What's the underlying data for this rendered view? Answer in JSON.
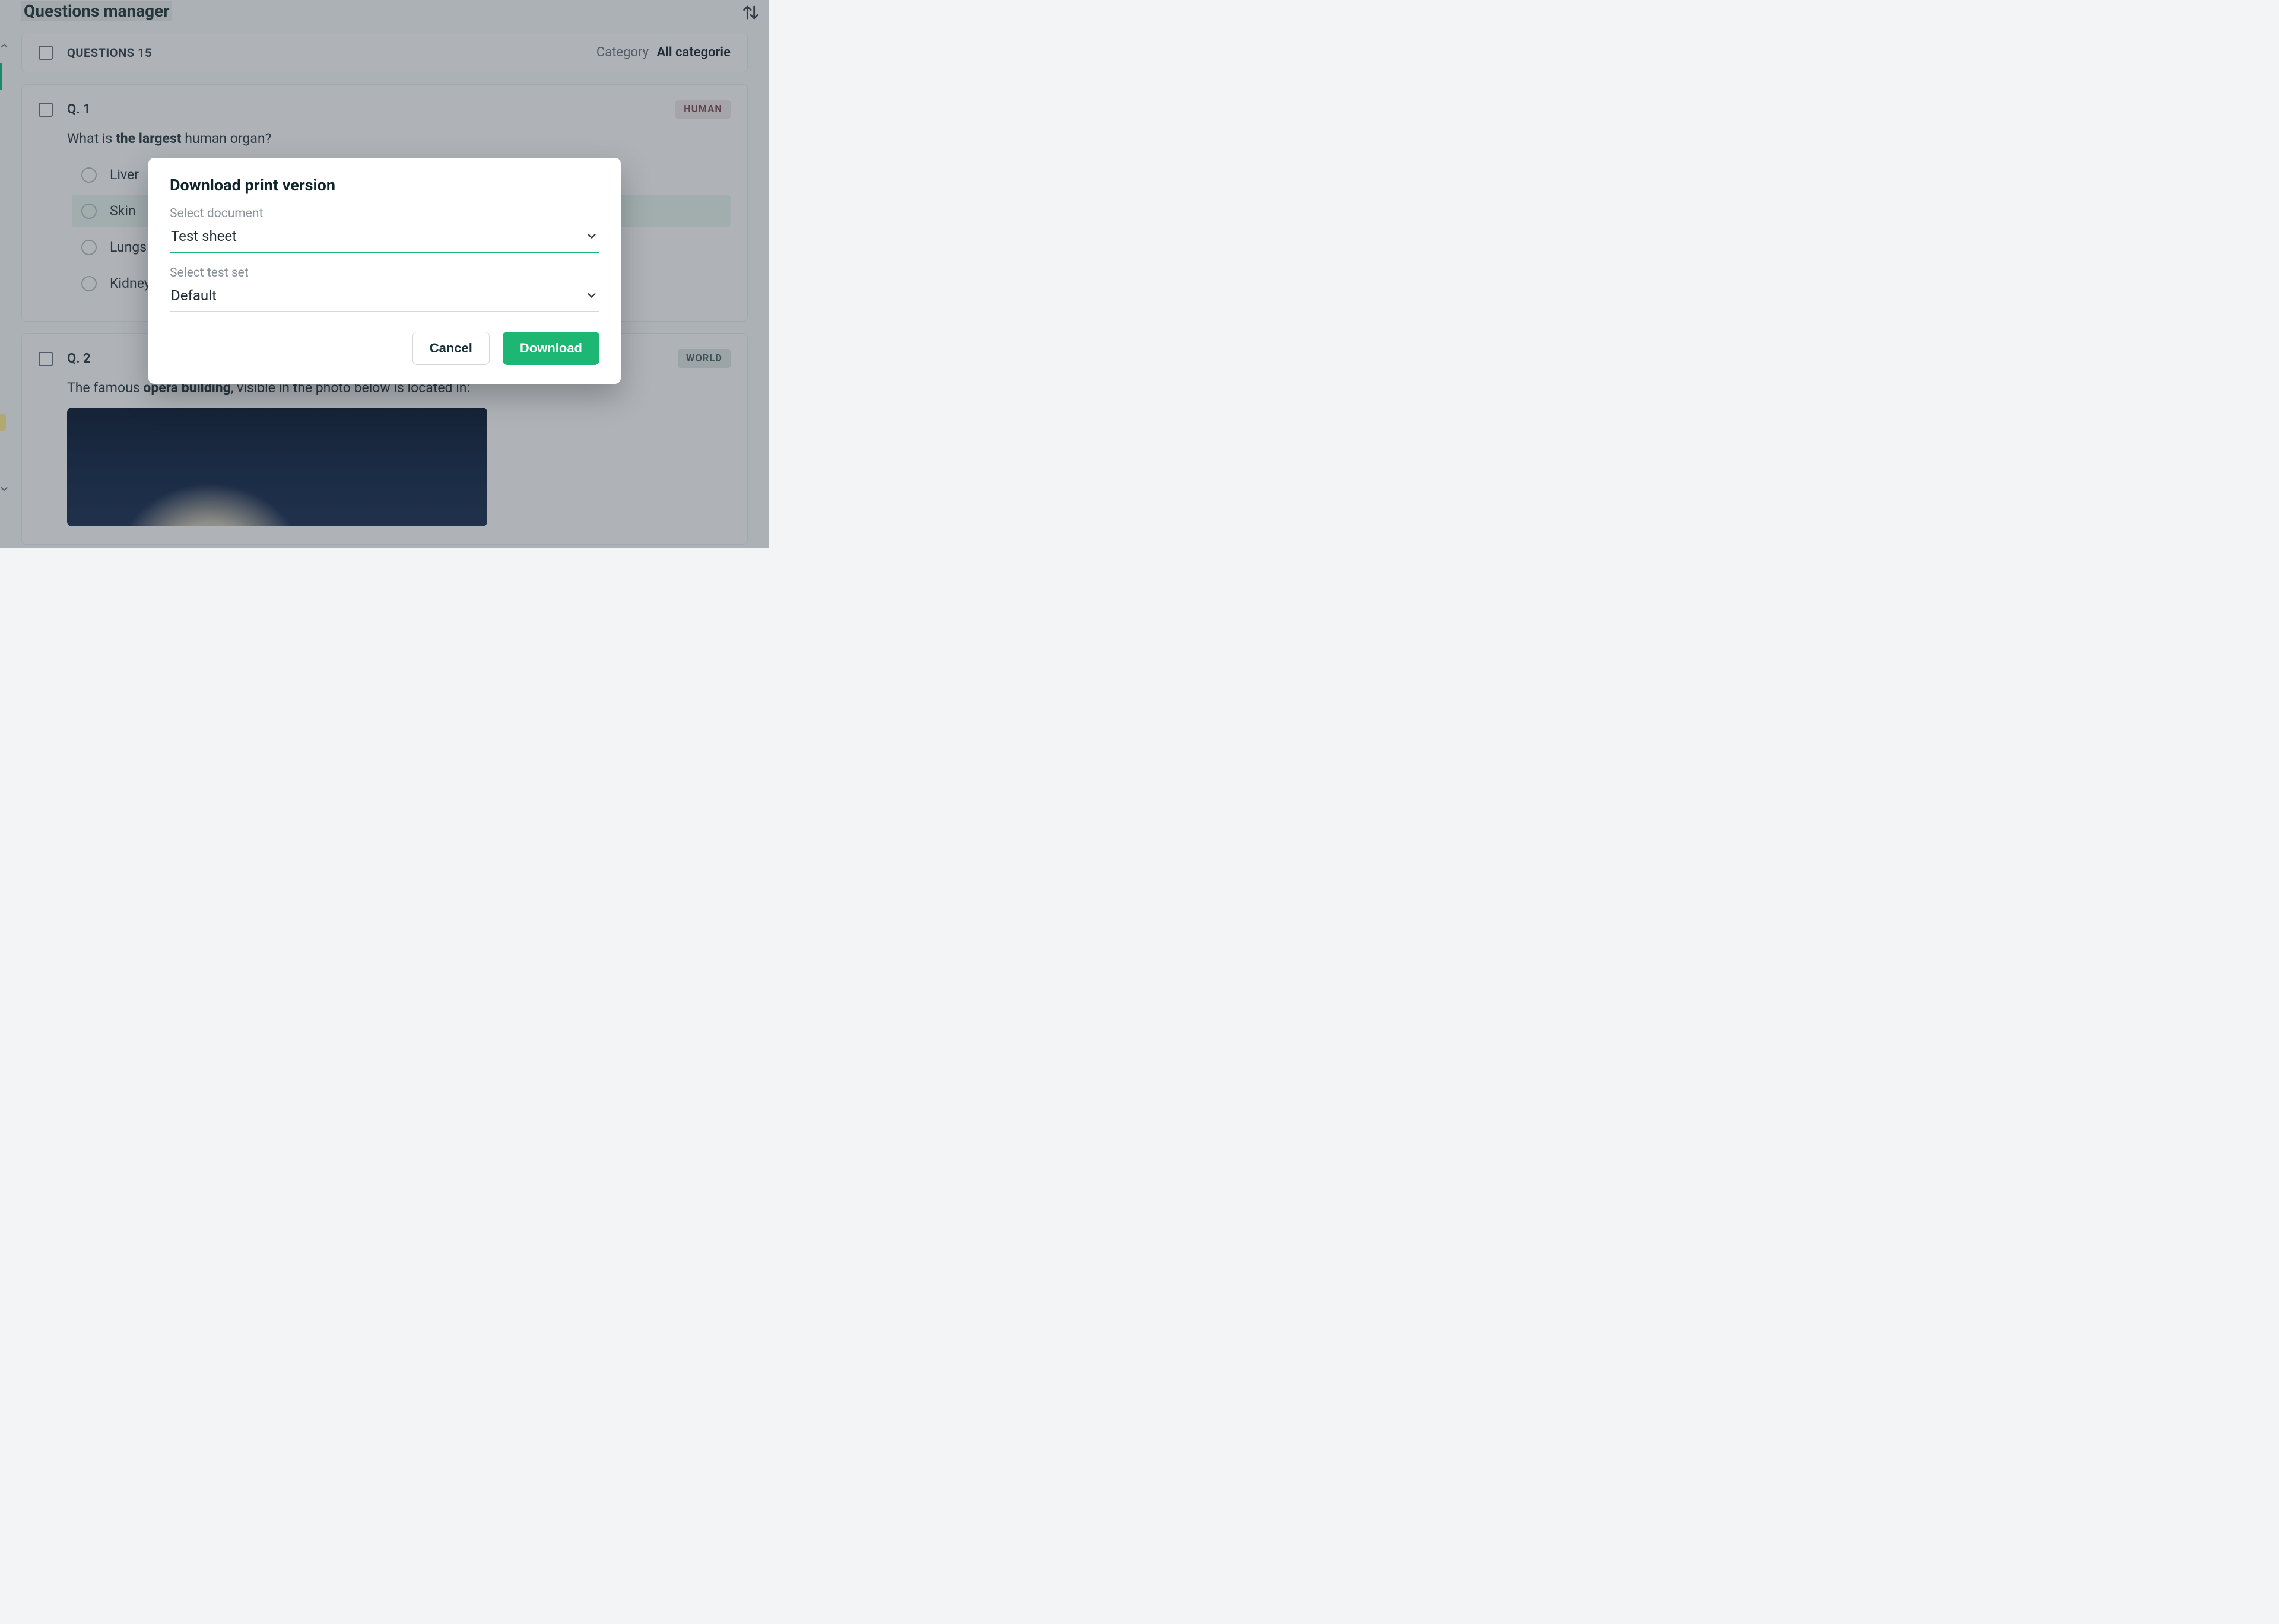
{
  "page": {
    "title": "Questions manager",
    "questions_label": "QUESTIONS 15",
    "category_label": "Category",
    "category_value": "All categorie"
  },
  "q1": {
    "num": "Q. 1",
    "tag": "HUMAN",
    "text_pre": "What is ",
    "text_bold": "the largest",
    "text_post": " human organ?",
    "options": [
      "Liver",
      "Skin",
      "Lungs",
      "Kidneys"
    ],
    "correct_index": 1
  },
  "q2": {
    "num": "Q. 2",
    "tag": "WORLD",
    "text_pre": "The famous ",
    "text_bold": "opera building",
    "text_post": ", visible in the photo below is located in:"
  },
  "modal": {
    "title": "Download print version",
    "field1_label": "Select document",
    "field1_value": "Test sheet",
    "field2_label": "Select test set",
    "field2_value": "Default",
    "cancel": "Cancel",
    "download": "Download"
  }
}
